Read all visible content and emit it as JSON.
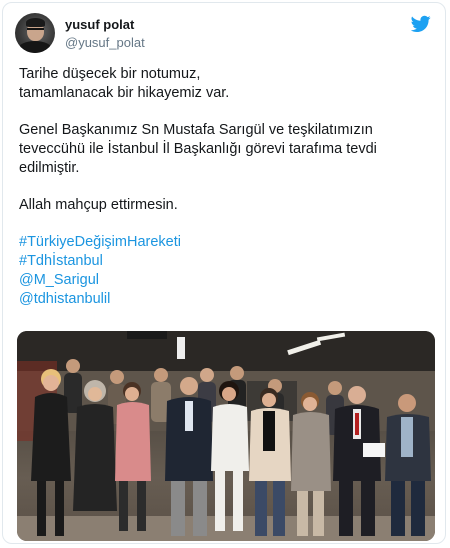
{
  "user": {
    "display_name": "yusuf polat",
    "handle": "@yusuf_polat"
  },
  "icons": {
    "brand": "twitter-bird-icon",
    "brand_color": "#1da1f2"
  },
  "tweet": {
    "line1": "Tarihe düşecek bir notumuz,",
    "line2": "tamamlanacak bir hikayemiz var.",
    "line3": "Genel Başkanımız Sn Mustafa Sarıgül ve teşkilatımızın",
    "line4": "teveccühü ile İstanbul İl Başkanlığı görevi tarafıma tevdi",
    "line5": "edilmiştir.",
    "line6": "Allah mahçup ettirmesin.",
    "hashtags": [
      "#TürkiyeDeğişimHareketi",
      "#Tdhİstanbul"
    ],
    "mentions": [
      "@M_Sarigul",
      "@tdhistanbulil"
    ],
    "link_color": "#1b95e0"
  }
}
